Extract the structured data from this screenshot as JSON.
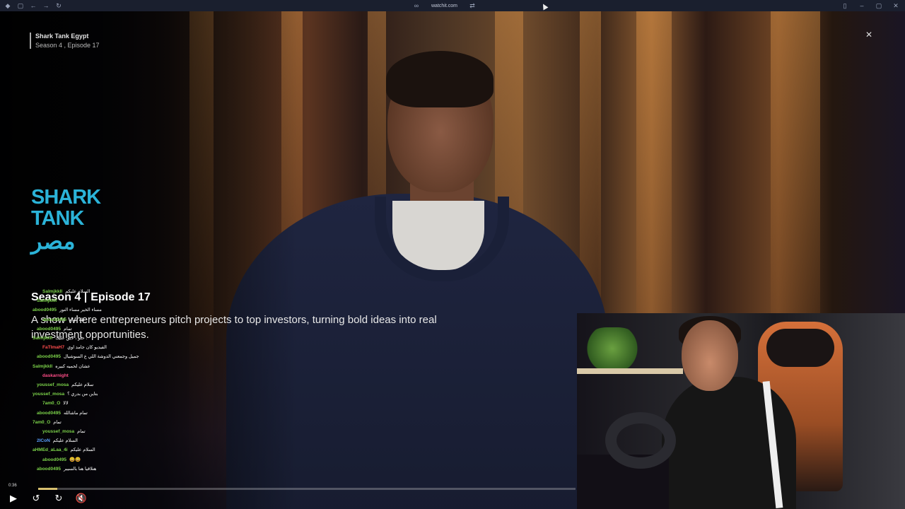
{
  "browser": {
    "url": "watchit.com"
  },
  "player": {
    "show_title": "Shark Tank Egypt",
    "show_subtitle": "Season 4 , Episode 17",
    "logo_line1": "SHARK",
    "logo_line2": "TANK",
    "logo_line3": "مصر",
    "season_label": "Season 4",
    "episode_label": "Episode 17",
    "description": "A show where entrepreneurs pitch projects to top investors, turning bold ideas into real investment opportunities.",
    "time": "0:36",
    "progress_fraction": 0.035,
    "accent_color": "#d8c070"
  },
  "chat": [
    {
      "user": "Salmjkkll",
      "msg": "السلام عليكم",
      "color": "#7cd34a"
    },
    {
      "user": "Salmjkkll",
      "msg": "",
      "color": "#7cd34a"
    },
    {
      "user": "abood0495",
      "msg": "مساء الخير مساء النور",
      "color": "#7cd34a"
    },
    {
      "user": "abood0495",
      "msg": "كله تمام",
      "color": "#7cd34a"
    },
    {
      "user": "abood0495",
      "msg": "تمام",
      "color": "#7cd34a"
    },
    {
      "user": "Salmjkkll",
      "msg": "حلو ، لايق عليك .",
      "color": "#7cd34a"
    },
    {
      "user": "FaTImaH7",
      "msg": "الفيديو كان جامد اوي",
      "color": "#ff4d4d"
    },
    {
      "user": "abood0495",
      "msg": "جميل وجمعني الدوشة اللي ع السوشيال",
      "color": "#7cd34a"
    },
    {
      "user": "Salmjkkll",
      "msg": "عشان لحميه كبيره",
      "color": "#7cd34a"
    },
    {
      "user": "daskarnight",
      "msg": "",
      "color": "#ff4d88"
    },
    {
      "user": "youssef_mosa",
      "msg": "سلام عليكم",
      "color": "#7cd34a"
    },
    {
      "user": "youssef_mosa",
      "msg": "بتاين من بدري ؟",
      "color": "#7cd34a"
    },
    {
      "user": "7am0_O",
      "msg": "لالا",
      "color": "#7cd34a"
    },
    {
      "user": "abood0495",
      "msg": "تمام ماشالله",
      "color": "#7cd34a"
    },
    {
      "user": "7am0_O",
      "msg": "تمام",
      "color": "#7cd34a"
    },
    {
      "user": "youssef_mosa",
      "msg": "تمام",
      "color": "#7cd34a"
    },
    {
      "user": "2ICoN",
      "msg": "السلام عليكم",
      "color": "#5aa0ff"
    },
    {
      "user": "aHMEd_aLaa_4i",
      "msg": "السلام عليكم",
      "color": "#7cd34a"
    },
    {
      "user": "abood0495",
      "msg": "😀😀",
      "color": "#7cd34a"
    },
    {
      "user": "abood0495",
      "msg": "هنلاقيا هنا بالسيبر",
      "color": "#7cd34a"
    }
  ]
}
